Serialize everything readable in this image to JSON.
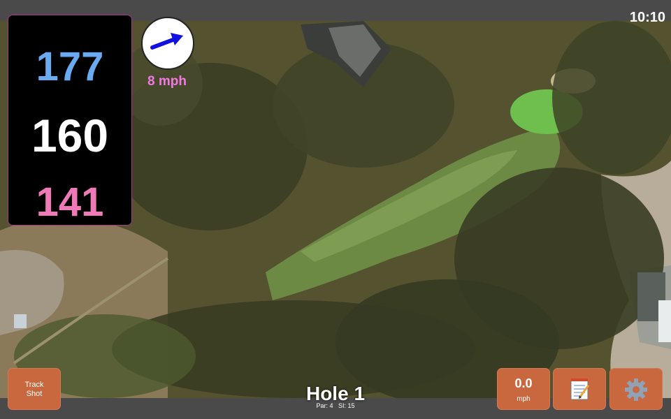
{
  "status_bar": {
    "time": "10:10"
  },
  "distances": {
    "back": "177",
    "middle": "160",
    "front": "141"
  },
  "wind": {
    "speed": "8 mph",
    "direction_icon": "arrow-right-icon",
    "arrow_color": "#1010e0"
  },
  "hole": {
    "title": "Hole 1",
    "par_label": "Par: 4",
    "si_label": "SI: 15"
  },
  "buttons": {
    "track_shot": "Track\nShot",
    "speed_value": "0.0",
    "speed_unit": "mph",
    "notes_icon": "notepad-icon",
    "settings_icon": "gear-icon"
  },
  "colors": {
    "back_distance": "#6aaaf0",
    "middle_distance": "#ffffff",
    "front_distance": "#f07ab8",
    "button_bg": "#c9673e",
    "wind_text": "#f07ae0"
  }
}
